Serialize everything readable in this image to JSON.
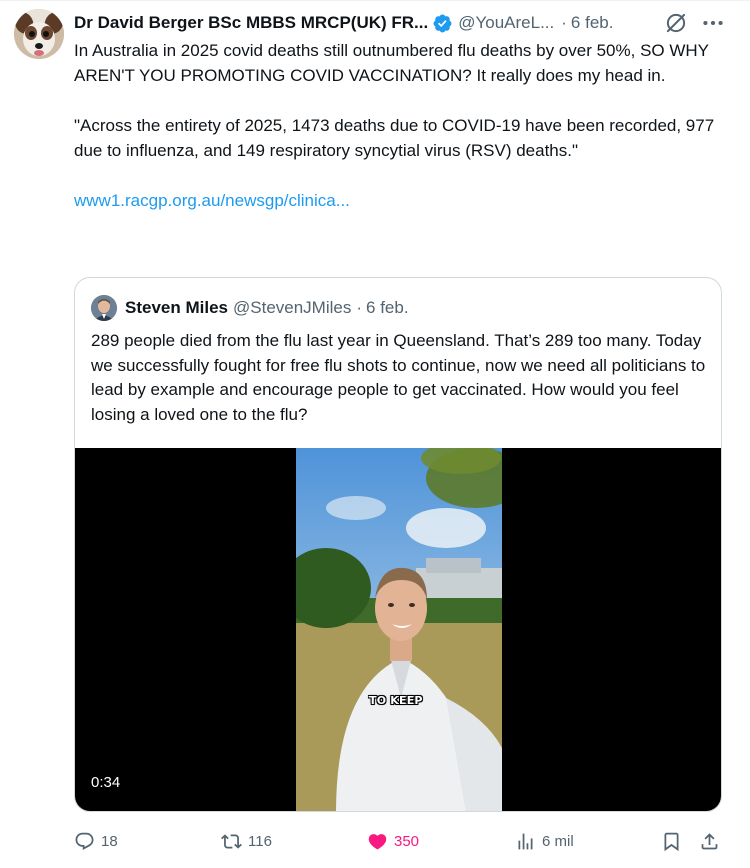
{
  "tweet": {
    "author_name": "Dr David Berger BSc MBBS MRCP(UK) FR...",
    "handle": "@YouAreL...",
    "separator": "·",
    "date": "6 feb.",
    "verified_icon": "verified-badge-icon",
    "text": {
      "p1": "In Australia in 2025 covid deaths still outnumbered flu deaths by over 50%, SO WHY AREN'T YOU PROMOTING COVID VACCINATION? It really does my head in.",
      "p2": "\"Across the entirety of 2025, 1473 deaths due to COVID-19 have been recorded, 977 due to influenza, and 149 respiratory syncytial virus (RSV) deaths.\"",
      "link": "www1.racgp.org.au/newsgp/clinica..."
    }
  },
  "quote": {
    "author_name": "Steven Miles",
    "handle": "@StevenJMiles",
    "separator": "·",
    "date": "6 feb.",
    "text": "289 people died from the flu last year in Queensland. That’s 289 too many. Today we successfully fought for free flu shots to continue, now we need all politicians to lead by example and encourage people to get vaccinated. How would you feel losing a loved one to the flu?",
    "video": {
      "caption": "TO KEEP",
      "duration": "0:34"
    }
  },
  "actions": {
    "replies": "18",
    "reposts": "116",
    "likes": "350",
    "views": "6 mil"
  },
  "colors": {
    "accent": "#1d9bf0",
    "like": "#f91880",
    "secondary_text": "#536471",
    "border": "#cfd9de"
  }
}
